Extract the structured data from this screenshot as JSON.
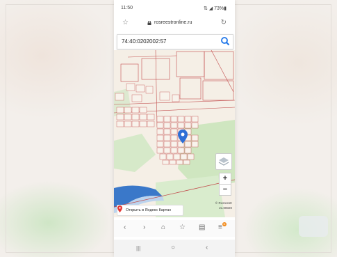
{
  "status_bar": {
    "time": "11:50",
    "indicators": "⇅ ◢ 73%▮"
  },
  "browser": {
    "url": "rosreestronline.ru"
  },
  "search": {
    "value": "74:40:0202002:57"
  },
  "map": {
    "open_yandex_label": "Открыть в Яндекс Картах",
    "attribution": "© Rosreestr",
    "scale": "21.08020"
  },
  "nav": {
    "back": "‹",
    "forward": "›",
    "home": "⌂",
    "bookmark": "☆",
    "tabs": "▤",
    "menu": "≡",
    "menu_badge": "N"
  },
  "system_nav": {
    "recents": "|||",
    "home": "○",
    "back": "‹"
  },
  "colors": {
    "accent": "#1a73e8",
    "pin": "#2d6fd6",
    "boundary": "#c24d4d",
    "forest": "#cfe6c0"
  },
  "icons": [
    "star-icon",
    "lock-icon",
    "reload-icon",
    "search-icon",
    "map-pin-icon",
    "layers-icon",
    "yandex-pin-icon",
    "back-icon",
    "forward-icon",
    "home-icon",
    "bookmark-icon",
    "tabs-icon",
    "menu-icon"
  ]
}
